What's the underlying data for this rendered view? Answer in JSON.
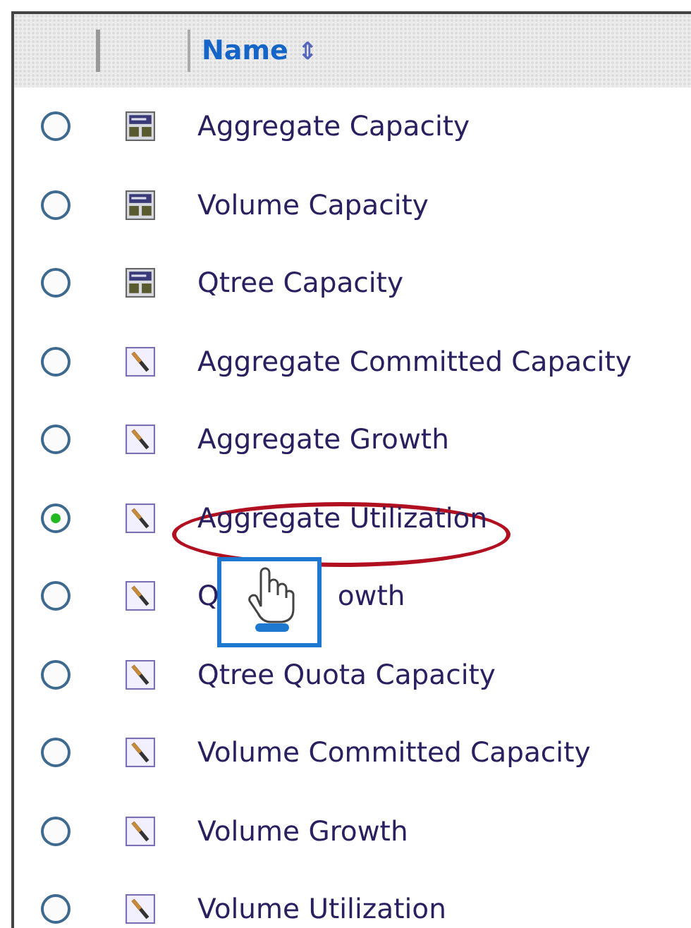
{
  "table": {
    "columns": [
      {
        "label": "Name",
        "sort_icon": "⇕"
      }
    ],
    "rows": [
      {
        "kind": "report",
        "name": "Aggregate Capacity",
        "selected": false,
        "highlighted": false,
        "cursor_over": false
      },
      {
        "kind": "report",
        "name": "Volume Capacity",
        "selected": false,
        "highlighted": false,
        "cursor_over": false
      },
      {
        "kind": "report",
        "name": "Qtree Capacity",
        "selected": false,
        "highlighted": false,
        "cursor_over": false
      },
      {
        "kind": "custom",
        "name": "Aggregate Committed Capacity",
        "selected": false,
        "highlighted": false,
        "cursor_over": false
      },
      {
        "kind": "custom",
        "name": "Aggregate Growth",
        "selected": false,
        "highlighted": false,
        "cursor_over": false
      },
      {
        "kind": "custom",
        "name": "Aggregate Utilization",
        "selected": true,
        "highlighted": true,
        "cursor_over": false
      },
      {
        "kind": "custom",
        "name": "Q",
        "name_after_cursor": "owth",
        "selected": false,
        "highlighted": false,
        "cursor_over": true
      },
      {
        "kind": "custom",
        "name": "Qtree Quota Capacity",
        "selected": false,
        "highlighted": false,
        "cursor_over": false
      },
      {
        "kind": "custom",
        "name": "Volume Committed Capacity",
        "selected": false,
        "highlighted": false,
        "cursor_over": false
      },
      {
        "kind": "custom",
        "name": "Volume Growth",
        "selected": false,
        "highlighted": false,
        "cursor_over": false
      },
      {
        "kind": "custom",
        "name": "Volume Utilization",
        "selected": false,
        "highlighted": false,
        "cursor_over": false
      }
    ]
  }
}
